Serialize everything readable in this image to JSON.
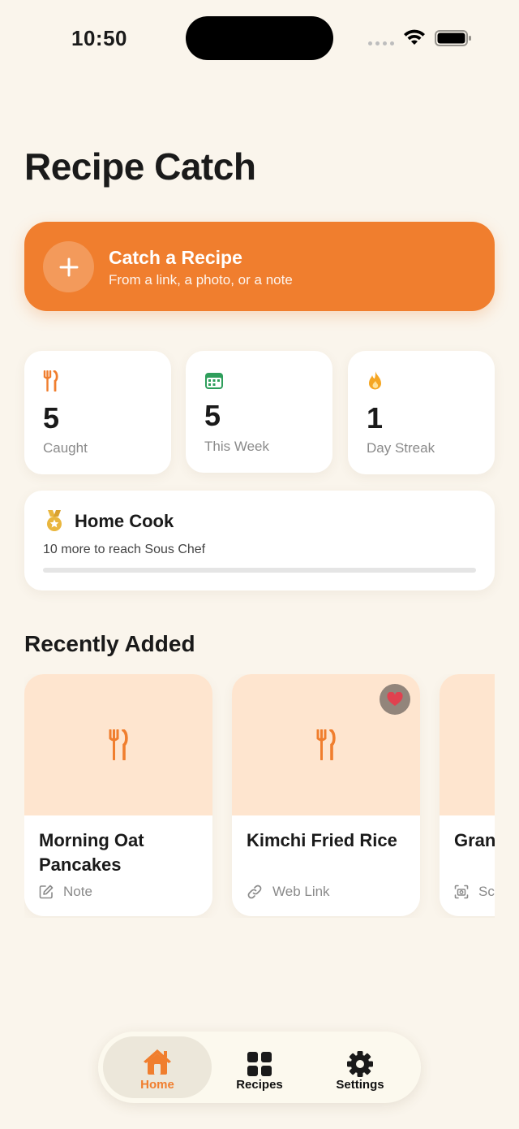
{
  "status": {
    "time": "10:50"
  },
  "title": "Recipe Catch",
  "catch": {
    "title": "Catch a Recipe",
    "subtitle": "From a link, a photo, or a note"
  },
  "stats": [
    {
      "value": "5",
      "label": "Caught",
      "icon": "fork-knife-icon"
    },
    {
      "value": "5",
      "label": "This Week",
      "icon": "calendar-icon"
    },
    {
      "value": "1",
      "label": "Day Streak",
      "icon": "flame-icon"
    }
  ],
  "level": {
    "title": "Home Cook",
    "subtitle": "10 more to reach Sous Chef",
    "progress": 0
  },
  "recently": {
    "title": "Recently Added",
    "items": [
      {
        "name": "Morning Oat Pancakes",
        "source": "Note",
        "source_icon": "note-icon",
        "favorite": false
      },
      {
        "name": "Kimchi Fried Rice",
        "source": "Web Link",
        "source_icon": "link-icon",
        "favorite": true
      },
      {
        "name": "Granola Butter",
        "source": "Scan",
        "source_icon": "scan-icon",
        "favorite": false
      }
    ]
  },
  "tabs": [
    {
      "label": "Home",
      "icon": "home-icon",
      "active": true
    },
    {
      "label": "Recipes",
      "icon": "grid-icon",
      "active": false
    },
    {
      "label": "Settings",
      "icon": "gear-icon",
      "active": false
    }
  ],
  "colors": {
    "accent": "#F07E2E",
    "background": "#FAF5EC",
    "thumb": "#FEE5CF",
    "heart": "#E0414F",
    "calendar": "#2E9E5B",
    "medal": "#E9B63E"
  }
}
